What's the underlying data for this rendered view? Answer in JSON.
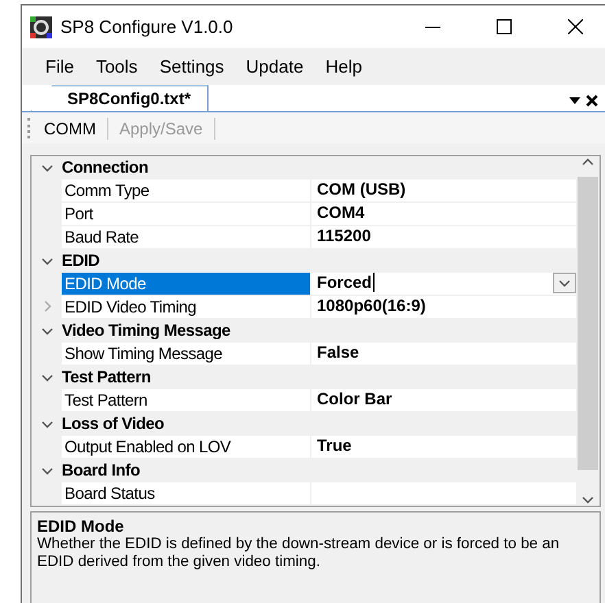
{
  "window": {
    "title": "SP8 Configure V1.0.0"
  },
  "menu": [
    "File",
    "Tools",
    "Settings",
    "Update",
    "Help"
  ],
  "tabs": [
    {
      "label": "SP8Config0.txt*",
      "selected": true
    }
  ],
  "toolbar": [
    {
      "label": "COMM",
      "disabled": false
    },
    {
      "label": "Apply/Save",
      "disabled": true
    }
  ],
  "property_grid": {
    "categories": [
      {
        "name": "Connection",
        "expanded": true,
        "children": [
          {
            "name": "Comm Type",
            "value": "COM (USB)",
            "selected": false
          },
          {
            "name": "Port",
            "value": "COM4",
            "selected": false
          },
          {
            "name": "Baud Rate",
            "value": "115200",
            "selected": false
          }
        ]
      },
      {
        "name": "EDID",
        "expanded": true,
        "children": [
          {
            "name": "EDID Mode",
            "value": "Forced",
            "selected": true
          },
          {
            "name": "EDID Video Timing",
            "value": "1080p60(16:9)",
            "selected": false,
            "expanded": false
          }
        ]
      },
      {
        "name": "Video Timing Message",
        "expanded": true,
        "children": [
          {
            "name": "Show Timing Message",
            "value": "False",
            "selected": false
          }
        ]
      },
      {
        "name": "Test Pattern",
        "expanded": true,
        "children": [
          {
            "name": "Test Pattern",
            "value": "Color Bar",
            "selected": false
          }
        ]
      },
      {
        "name": "Loss of Video",
        "expanded": true,
        "children": [
          {
            "name": "Output Enabled on LOV",
            "value": "True",
            "selected": false
          }
        ]
      },
      {
        "name": "Board Info",
        "expanded": true,
        "children": [
          {
            "name": "Board Status",
            "selected": false
          }
        ]
      }
    ]
  },
  "description": {
    "title": "EDID Mode",
    "text": "Whether the EDID is defined by the down-stream device or is forced to be an EDID derived from the given video timing."
  }
}
